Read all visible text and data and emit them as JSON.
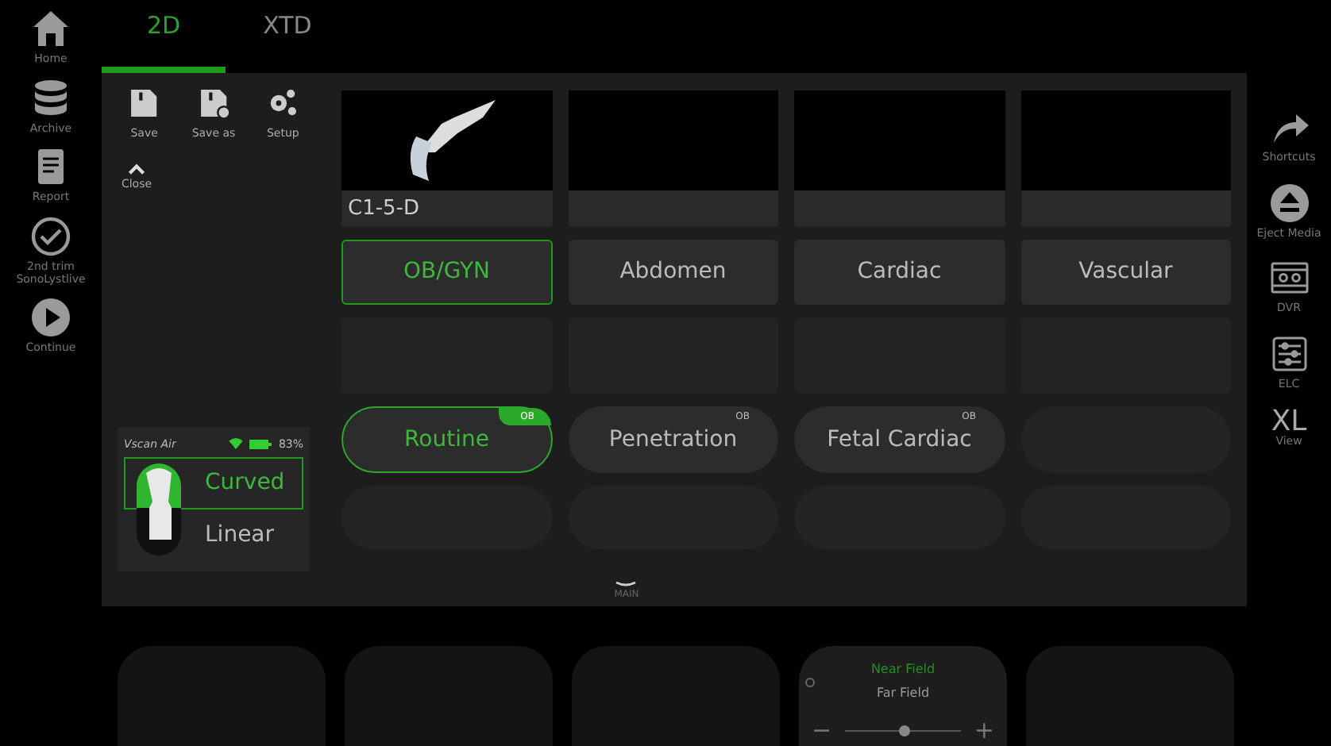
{
  "left_nav": [
    {
      "kind": "home",
      "label": "Home"
    },
    {
      "kind": "archive",
      "label": "Archive"
    },
    {
      "kind": "report",
      "label": "Report"
    },
    {
      "kind": "check",
      "label": "2nd trim SonoLystlive"
    },
    {
      "kind": "play",
      "label": "Continue"
    }
  ],
  "tabs": [
    {
      "label": "2D",
      "selected": true
    },
    {
      "label": "XTD",
      "selected": false
    }
  ],
  "toolbar": [
    {
      "kind": "save",
      "label": "Save"
    },
    {
      "kind": "save-as",
      "label": "Save as"
    },
    {
      "kind": "setup",
      "label": "Setup"
    }
  ],
  "close": {
    "label": "Close"
  },
  "probe_card": {
    "name": "Vscan Air",
    "battery": "83%",
    "options": [
      {
        "label": "Curved",
        "selected": true
      },
      {
        "label": "Linear",
        "selected": false
      }
    ]
  },
  "probes": [
    {
      "label": "C1-5-D"
    }
  ],
  "presets": [
    {
      "label": "OB/GYN",
      "selected": true
    },
    {
      "label": "Abdomen",
      "selected": false
    },
    {
      "label": "Cardiac",
      "selected": false
    },
    {
      "label": "Vascular",
      "selected": false
    }
  ],
  "protocols": [
    {
      "label": "Routine",
      "tag": "OB",
      "selected": true
    },
    {
      "label": "Penetration",
      "tag": "OB",
      "selected": false
    },
    {
      "label": "Fetal Cardiac",
      "tag": "OB",
      "selected": false
    }
  ],
  "handle": {
    "label": "MAIN"
  },
  "right_nav": [
    {
      "kind": "shortcuts",
      "label": "Shortcuts"
    },
    {
      "kind": "eject",
      "label": "Eject Media"
    },
    {
      "kind": "dvr",
      "label": "DVR"
    },
    {
      "kind": "elc",
      "label": "ELC"
    },
    {
      "kind": "xl",
      "glyph": "XL",
      "label": "View"
    }
  ],
  "knob": {
    "options": [
      {
        "label": "Near Field",
        "selected": true
      },
      {
        "label": "Far Field",
        "selected": false
      }
    ],
    "minus": "−",
    "plus": "+",
    "level": 0.5
  }
}
